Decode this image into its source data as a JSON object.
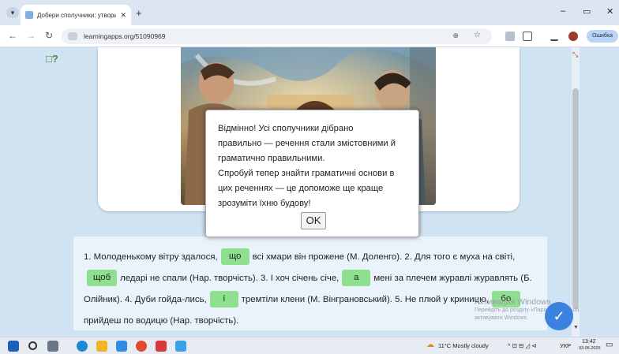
{
  "browser": {
    "tab_title": "Добери сполучники: утвори ск",
    "tab_close": "✕",
    "new_tab": "+",
    "url": "learningapps.org/51090969",
    "error_button": "Ошибка",
    "min": "–",
    "max": "▭",
    "close": "✕"
  },
  "dialog": {
    "lines": [
      "Відмінно! Усі сполучники дібрано",
      "правильно — речення стали змістовними й",
      "граматично правильними.",
      "Спробуй тепер знайти граматичні основи в",
      "цих реченнях — це допоможе ще краще",
      "зрозуміти їхню будову!"
    ],
    "ok_label": "OK"
  },
  "task": {
    "s1": "1. Молоденькому вітру здалося,",
    "c1": "що",
    "s2": "всі хмари він прожене (М. Доленго). 2. Для того є муха на",
    "s3": "світі,",
    "c2": "щоб",
    "s4": "ледарі не спали (Нар. творчість). 3. І хоч січень січе,",
    "c3": "а",
    "s5": "мені за плечем журавлі",
    "s6": "журавлять (Б. Олійник). 4. Дуби гойда-лись,",
    "c4": "і",
    "s7": "тремтіли клени (М. Вінграновський). 5. Не плюй у",
    "s8": "криницю,",
    "c5": "бо",
    "s9": "прийдеш по водицю (Нар. творчість)."
  },
  "activation": {
    "title": "Активация Windows",
    "sub1": "Перейдіть до розділу «Параметри», щоб",
    "sub2": "активувати Windows."
  },
  "taskbar": {
    "weather": "11°C  Mostly cloudy",
    "lang": "УКР",
    "time": "13:42",
    "date": "03.06.2025"
  },
  "colors": {
    "chip": "#8ee08e",
    "page_bg": "#cfe3f2",
    "check_button": "#3b82e0"
  }
}
